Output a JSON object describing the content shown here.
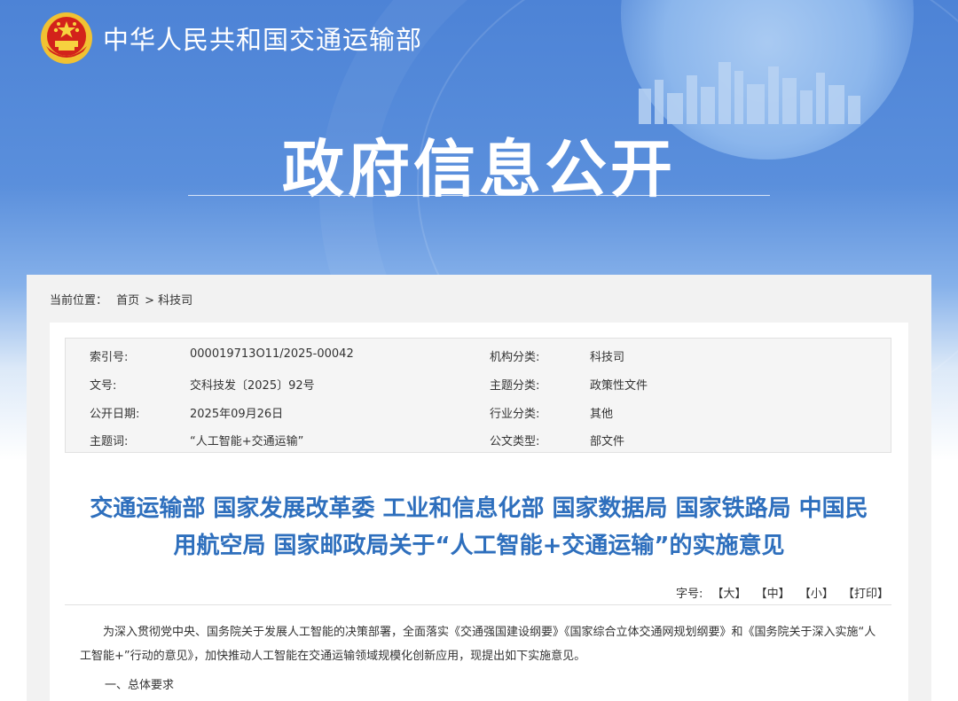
{
  "header": {
    "site_title": "中华人民共和国交通运输部",
    "banner_title": "政府信息公开"
  },
  "breadcrumb": {
    "label": "当前位置：",
    "items": [
      "首页",
      "科技司"
    ],
    "separator": ">"
  },
  "meta": {
    "rows": [
      {
        "label1": "索引号:",
        "value1": "000019713O11/2025-00042",
        "label2": "机构分类:",
        "value2": "科技司"
      },
      {
        "label1": "文号:",
        "value1": "交科技发〔2025〕92号",
        "label2": "主题分类:",
        "value2": "政策性文件"
      },
      {
        "label1": "公开日期:",
        "value1": "2025年09月26日",
        "label2": "行业分类:",
        "value2": "其他"
      },
      {
        "label1": "主题词:",
        "value1": "“人工智能+交通运输”",
        "label2": "公文类型:",
        "value2": "部文件"
      }
    ]
  },
  "document": {
    "title_line1": "交通运输部 国家发展改革委 工业和信息化部 国家数据局 国家铁路局 中国民",
    "title_line2": "用航空局 国家邮政局关于“人工智能+交通运输”的实施意见",
    "font_size_label": "字号:",
    "font_large": "【大】",
    "font_medium": "【中】",
    "font_small": "【小】",
    "print": "【打印】",
    "paragraph1": "为深入贯彻党中央、国务院关于发展人工智能的决策部署，全面落实《交通强国建设纲要》《国家综合立体交通网规划纲要》和《国务院关于深入实施“人工智能+”行动的意见》，加快推动人工智能在交通运输领域规模化创新应用，现提出如下实施意见。",
    "section1": "一、总体要求"
  },
  "colors": {
    "banner_blue": "#4d83d6",
    "title_blue": "#2e6fbd"
  }
}
